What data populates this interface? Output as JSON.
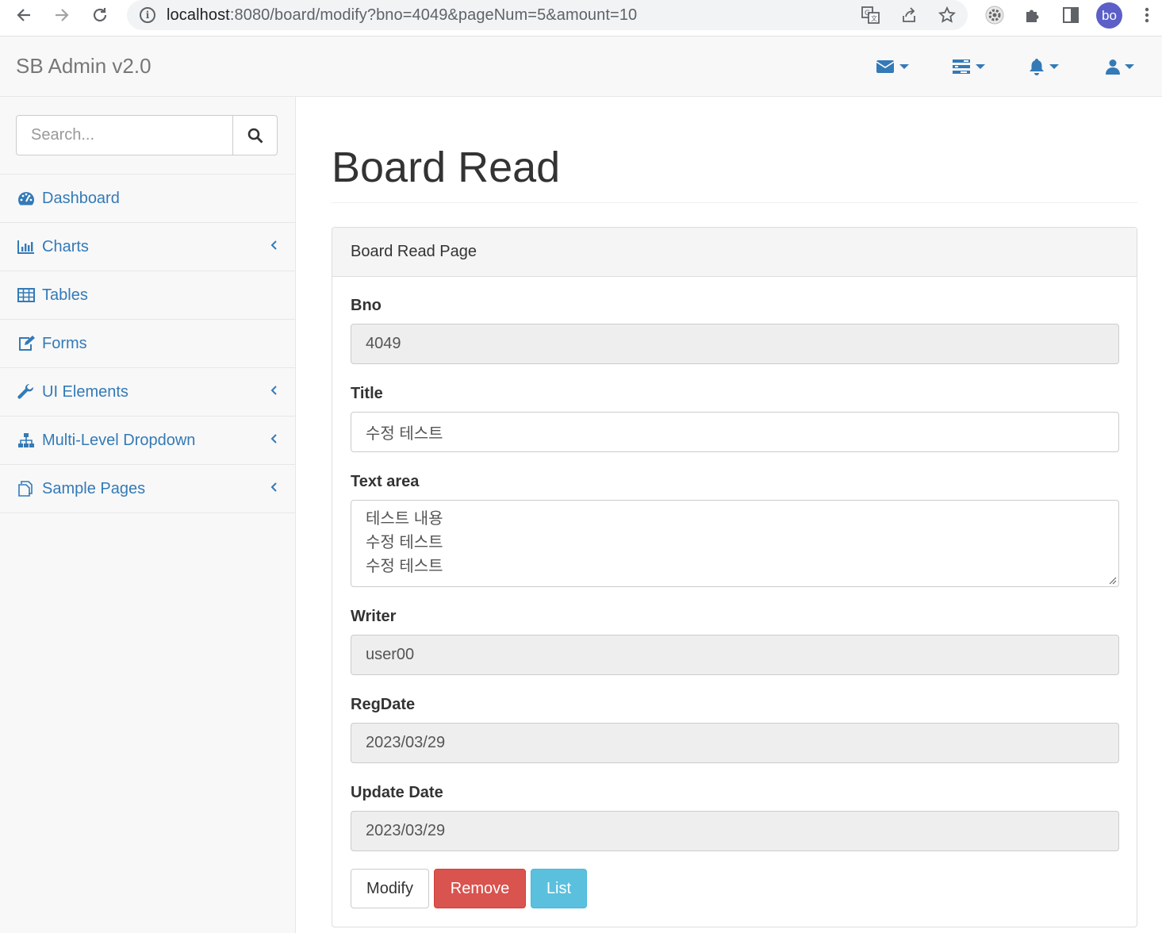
{
  "browser": {
    "url_host": "localhost",
    "url_rest": ":8080/board/modify?bno=4049&pageNum=5&amount=10",
    "avatar_text": "bo",
    "icons": [
      "back-icon",
      "forward-icon",
      "reload-icon",
      "info-icon",
      "translate-icon",
      "share-icon",
      "star-icon",
      "extension-settings-icon",
      "puzzle-icon",
      "side-panel-icon",
      "more-icon"
    ]
  },
  "navbar": {
    "brand": "SB Admin v2.0",
    "dropdowns": [
      "envelope-icon",
      "tasks-icon",
      "bell-icon",
      "user-icon"
    ]
  },
  "sidebar": {
    "search_placeholder": "Search...",
    "items": [
      {
        "label": "Dashboard",
        "icon": "dashboard-icon",
        "has_arrow": false
      },
      {
        "label": "Charts",
        "icon": "bar-chart-icon",
        "has_arrow": true
      },
      {
        "label": "Tables",
        "icon": "table-icon",
        "has_arrow": false
      },
      {
        "label": "Forms",
        "icon": "edit-icon",
        "has_arrow": false
      },
      {
        "label": "UI Elements",
        "icon": "wrench-icon",
        "has_arrow": true
      },
      {
        "label": "Multi-Level Dropdown",
        "icon": "sitemap-icon",
        "has_arrow": true
      },
      {
        "label": "Sample Pages",
        "icon": "files-icon",
        "has_arrow": true
      }
    ]
  },
  "main": {
    "page_title": "Board Read",
    "panel_heading": "Board Read Page",
    "fields": {
      "bno": {
        "label": "Bno",
        "value": "4049"
      },
      "title": {
        "label": "Title",
        "value": "수정 테스트"
      },
      "content": {
        "label": "Text area",
        "value": "테스트 내용\n수정 테스트\n수정 테스트"
      },
      "writer": {
        "label": "Writer",
        "value": "user00"
      },
      "regdate": {
        "label": "RegDate",
        "value": "2023/03/29"
      },
      "updatedate": {
        "label": "Update Date",
        "value": "2023/03/29"
      }
    },
    "buttons": {
      "modify": "Modify",
      "remove": "Remove",
      "list": "List"
    }
  },
  "colors": {
    "link": "#337ab7",
    "danger": "#d9534f",
    "info": "#5bc0de"
  }
}
